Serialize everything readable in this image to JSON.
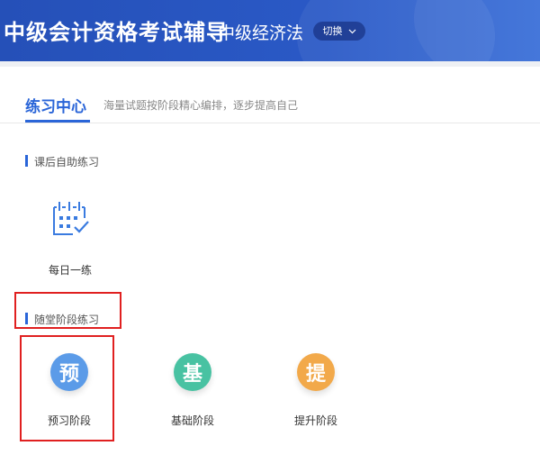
{
  "header": {
    "title": "中级会计资格考试辅导",
    "subject": "中级经济法",
    "switch_label": "切换",
    "switch_icon": "chevron-down-icon"
  },
  "tab": {
    "title": "练习中心",
    "description": "海量试题按阶段精心编排，逐步提高自己"
  },
  "sections": [
    {
      "label": "课后自助练习",
      "items": [
        {
          "label": "每日一练",
          "icon": "calendar-check-icon",
          "color": "#3a7be0"
        }
      ]
    },
    {
      "label": "随堂阶段练习",
      "items": [
        {
          "glyph": "预",
          "label": "预习阶段",
          "color": "#5b9be8"
        },
        {
          "glyph": "基",
          "label": "基础阶段",
          "color": "#48c2a2"
        },
        {
          "glyph": "提",
          "label": "提升阶段",
          "color": "#f2a94a"
        }
      ]
    }
  ],
  "highlight_color": "#e02020"
}
